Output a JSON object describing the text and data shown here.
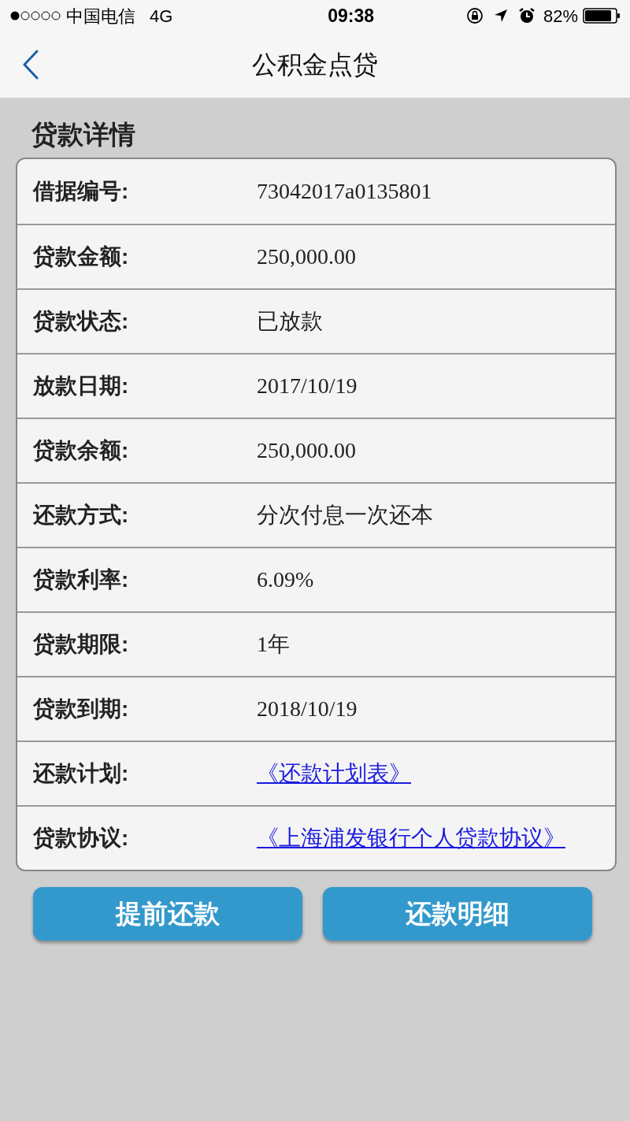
{
  "status_bar": {
    "carrier": "中国电信",
    "network": "4G",
    "time": "09:38",
    "battery": "82%"
  },
  "nav": {
    "title": "公积金点贷"
  },
  "section_title": "贷款详情",
  "rows": [
    {
      "label": "借据编号:",
      "value": "73042017a0135801",
      "kind": "text"
    },
    {
      "label": "贷款金额:",
      "value": "250,000.00",
      "kind": "text"
    },
    {
      "label": "贷款状态:",
      "value": "已放款",
      "kind": "text"
    },
    {
      "label": "放款日期:",
      "value": "2017/10/19",
      "kind": "text"
    },
    {
      "label": "贷款余额:",
      "value": "250,000.00",
      "kind": "text"
    },
    {
      "label": "还款方式:",
      "value": "分次付息一次还本",
      "kind": "text"
    },
    {
      "label": "贷款利率:",
      "value": "6.09%",
      "kind": "text"
    },
    {
      "label": "贷款期限:",
      "value": "1年",
      "kind": "text"
    },
    {
      "label": "贷款到期:",
      "value": "2018/10/19",
      "kind": "text"
    },
    {
      "label": "还款计划:",
      "value": "《还款计划表》",
      "kind": "link"
    },
    {
      "label": "贷款协议:",
      "value": "《上海浦发银行个人贷款协议》",
      "kind": "link"
    }
  ],
  "buttons": [
    "提前还款",
    "还款明细"
  ]
}
